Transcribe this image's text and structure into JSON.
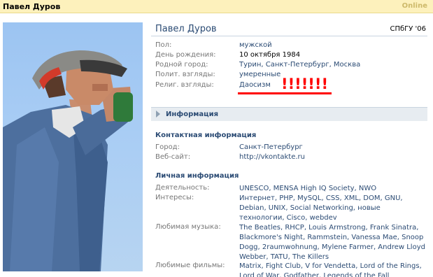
{
  "topbar": {
    "name": "Павел Дуров",
    "status": "Online"
  },
  "profile": {
    "name": "Павел Дуров",
    "university": "СПбГУ '06",
    "fields": [
      {
        "label": "Пол:",
        "value": "мужской"
      },
      {
        "label": "День рождения:",
        "value": "10 октября 1984"
      },
      {
        "label": "Родной город:",
        "value": "Турин, Санкт-Петербург, Москва"
      },
      {
        "label": "Полит. взгляды:",
        "value": "умеренные"
      },
      {
        "label": "Религ. взгляды:",
        "value": "Даосизм"
      }
    ],
    "annotation": "!!!!!!!"
  },
  "info_section": {
    "title": "Информация",
    "contact": {
      "heading": "Контактная информация",
      "fields": [
        {
          "label": "Город:",
          "value": "Санкт-Петербург"
        },
        {
          "label": "Веб-сайт:",
          "value": "http://vkontakte.ru"
        }
      ]
    },
    "personal": {
      "heading": "Личная информация",
      "fields": [
        {
          "label": "Деятельность:",
          "value": "UNESCO, MENSA High IQ Society, NWO"
        },
        {
          "label": "Интересы:",
          "value": "Интернет, PHP, MySQL, CSS, XML, DOM, GNU, Debian, UNIX, Social Networking, новые технологии, Cisco, webdev"
        },
        {
          "label": "Любимая музыка:",
          "value": "The Beatles, RHCP, Louis Armstrong, Frank Sinatra, Blackmore's Night, Rammstein, Vanessa Mae, Snoop Dogg, 2raumwohnung, Mylene Farmer, Andrew Lloyd Webber, TATU, The Killers"
        },
        {
          "label": "Любимые фильмы:",
          "value": "Matrix, Fight Club, V for Vendetta, Lord of the Rings, Lord of War, Godfather, Legends of the Fall"
        }
      ]
    }
  },
  "colors": {
    "link": "#2b4b74",
    "topbar": "#fdf1bc",
    "section_bar": "#e7ecf1",
    "annotation": "#ff0000"
  }
}
